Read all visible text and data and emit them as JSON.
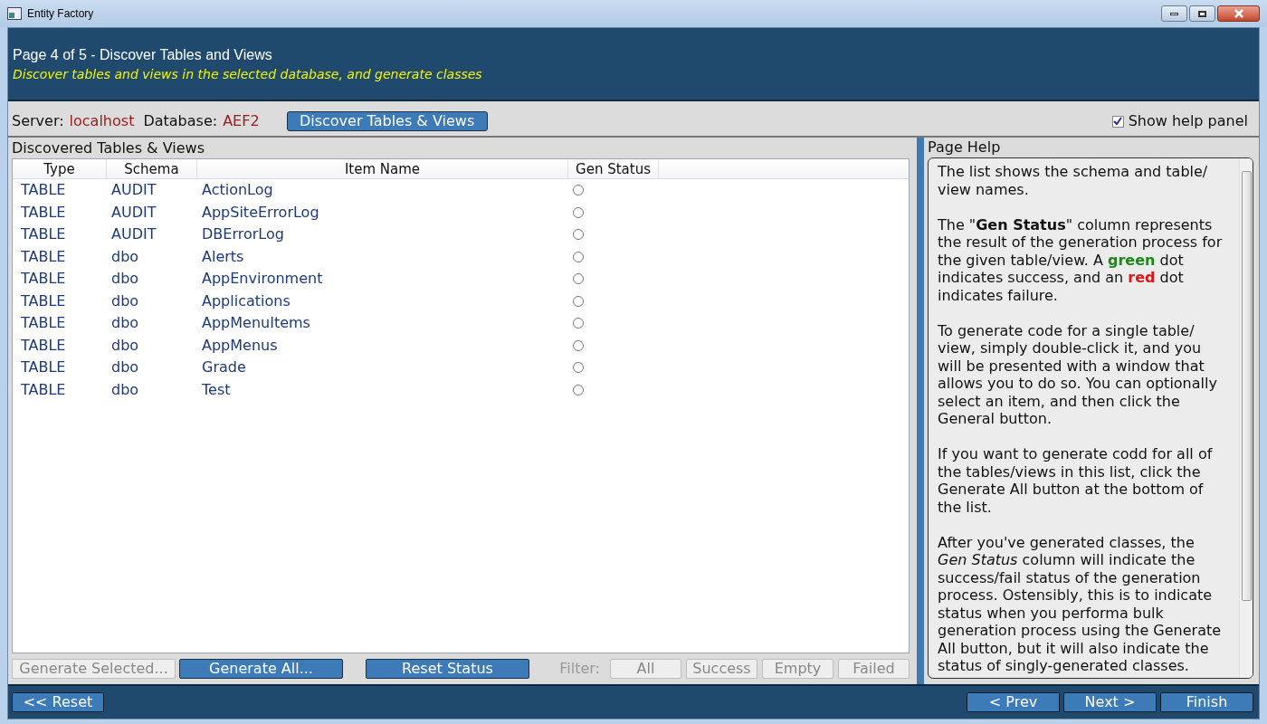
{
  "window": {
    "title": "Entity Factory"
  },
  "header": {
    "title": "Page 4 of 5 - Discover Tables and Views",
    "subtitle": "Discover tables and views in the selected database, and generate classes"
  },
  "connection": {
    "server_label": "Server:",
    "server": "localhost",
    "database_label": "Database:",
    "database": "AEF2",
    "discover_button": "Discover Tables & Views"
  },
  "show_help": {
    "label": "Show help panel",
    "checked": true
  },
  "list": {
    "title": "Discovered Tables & Views",
    "columns": [
      "Type",
      "Schema",
      "Item Name",
      "Gen Status"
    ],
    "rows": [
      {
        "type": "TABLE",
        "schema": "AUDIT",
        "name": "ActionLog",
        "success": false,
        "failed": false
      },
      {
        "type": "TABLE",
        "schema": "AUDIT",
        "name": "AppSiteErrorLog",
        "success": false,
        "failed": false
      },
      {
        "type": "TABLE",
        "schema": "AUDIT",
        "name": "DBErrorLog",
        "success": false,
        "failed": false
      },
      {
        "type": "TABLE",
        "schema": "dbo",
        "name": "Alerts",
        "success": false,
        "failed": false
      },
      {
        "type": "TABLE",
        "schema": "dbo",
        "name": "AppEnvironment",
        "success": false,
        "failed": false
      },
      {
        "type": "TABLE",
        "schema": "dbo",
        "name": "Applications",
        "success": false,
        "failed": false
      },
      {
        "type": "TABLE",
        "schema": "dbo",
        "name": "AppMenuItems",
        "success": false,
        "failed": false
      },
      {
        "type": "TABLE",
        "schema": "dbo",
        "name": "AppMenus",
        "success": false,
        "failed": false
      },
      {
        "type": "TABLE",
        "schema": "dbo",
        "name": "Grade",
        "success": false,
        "failed": false
      },
      {
        "type": "TABLE",
        "schema": "dbo",
        "name": "Test",
        "success": false,
        "failed": false
      }
    ]
  },
  "actions": [
    {
      "label": "Generate Selected...",
      "disabled": true
    },
    {
      "label": "Generate All...",
      "disabled": false
    },
    {
      "label": "Reset Status",
      "disabled": false
    }
  ],
  "filter": {
    "label": "Filter:",
    "buttons": [
      {
        "label": "All",
        "disabled": true
      },
      {
        "label": "Success",
        "disabled": true
      },
      {
        "label": "Empty",
        "disabled": true
      },
      {
        "label": "Failed",
        "disabled": true
      }
    ]
  },
  "help": {
    "title": "Page Help",
    "paragraphs": [
      [
        {
          "text": "The list shows the schema and table/ view names."
        }
      ],
      [
        {
          "text": "The \"**Gen Status**\" column represents the result of the generation process for the given table/view. A "
        },
        {
          "text": "**green**",
          "color": "#1a8a1a"
        },
        {
          "text": " dot indicates success, and an "
        },
        {
          "text": "**red**",
          "color": "#e01818"
        },
        {
          "text": " dot indicates failure."
        }
      ],
      [
        {
          "text": "To generate code for a single table/ view, simply double-click it, and you will be presented with a window that allows you to do so. You can optionally select an item, and then click the General button."
        }
      ],
      [
        {
          "text": "If you want to generate codd for all of the tables/views in this list, click the Generate All button at the bottom of the list."
        }
      ],
      [
        {
          "text": "After you've generated classes, the *Gen Status* column will indicate the success/fail status of the generation process. Ostensibly, this is to indicate status when you performa bulk generation process using the Generate All button, but it will also indicate the status of singly-generated classes."
        }
      ]
    ]
  },
  "footer": {
    "reset": "<< Reset",
    "prev": "< Prev",
    "next": "Next >",
    "finish": "Finish"
  }
}
